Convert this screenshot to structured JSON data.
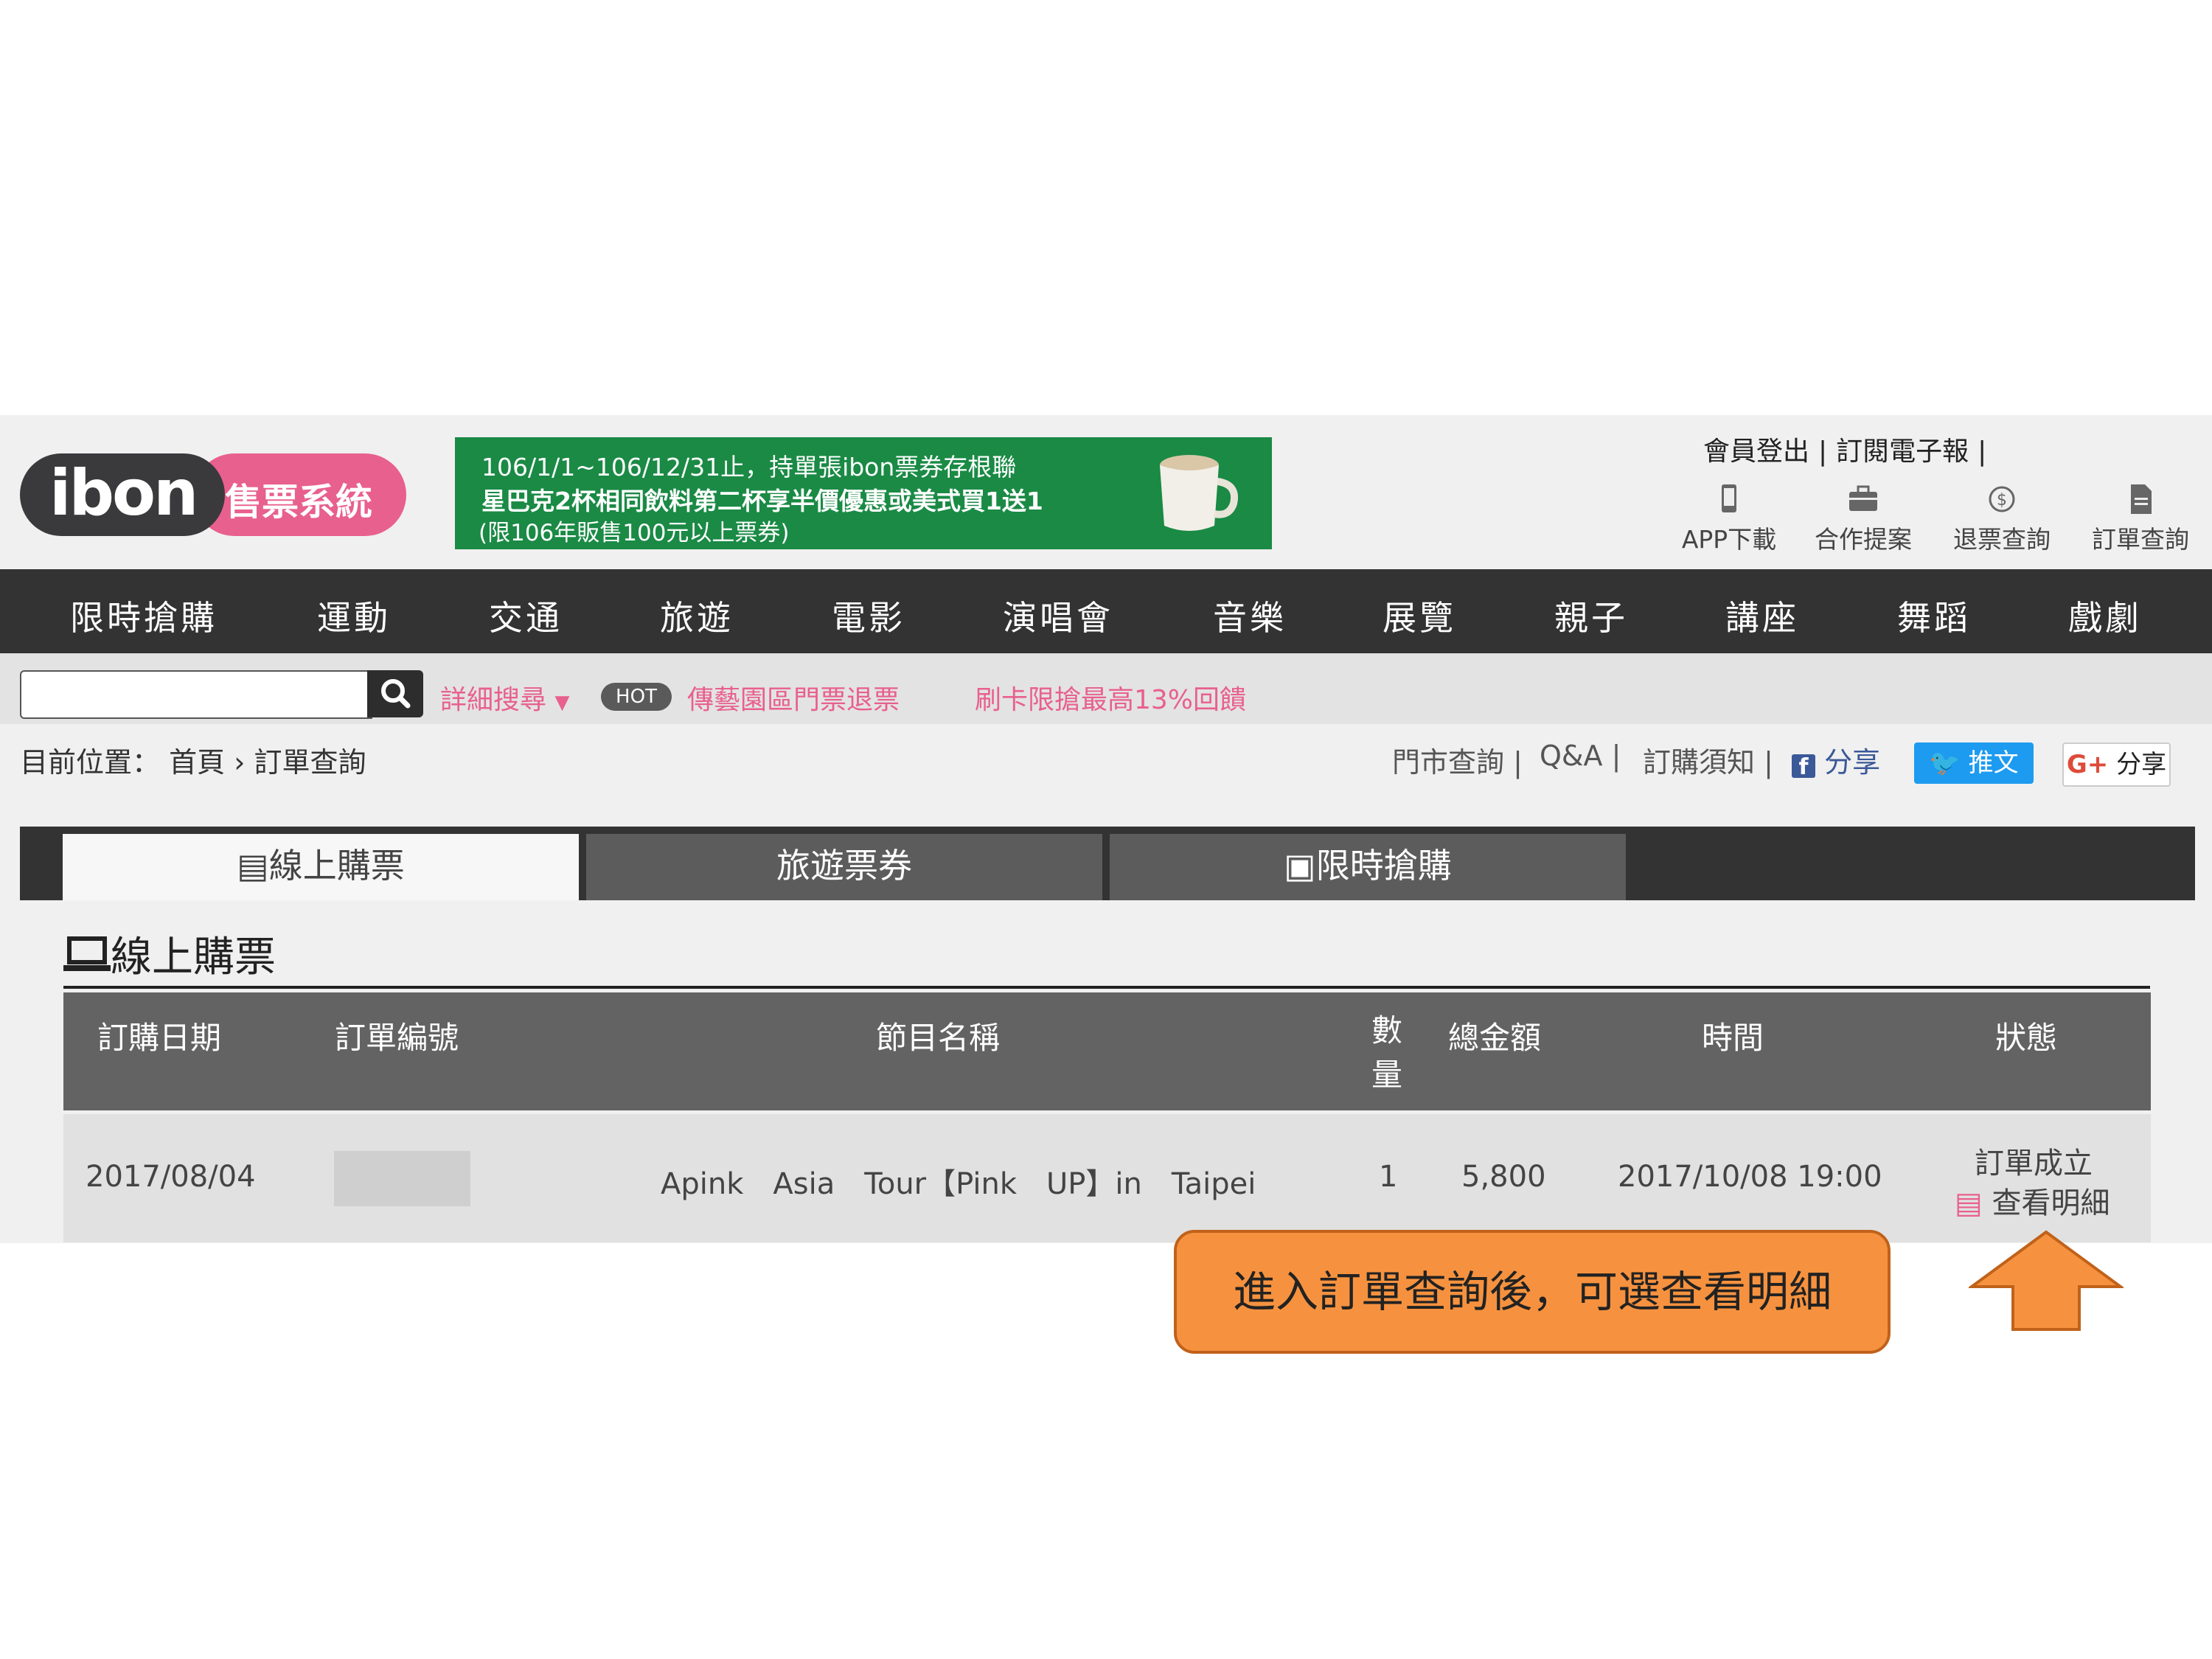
{
  "header": {
    "logo_text": "ibon",
    "logo_sub": "售票系統",
    "banner": {
      "line1": "106/1/1~106/12/31止，持單張ibon票券存根聯",
      "line2": "星巴克2杯相同飲料第二杯享半價優惠或美式買1送1",
      "line3": "(限106年販售100元以上票券)"
    },
    "top_links": [
      "會員登出",
      "訂閱電子報"
    ],
    "tools": [
      {
        "label": "APP下載",
        "icon": "mobile-icon"
      },
      {
        "label": "合作提案",
        "icon": "briefcase-icon"
      },
      {
        "label": "退票查詢",
        "icon": "refund-icon"
      },
      {
        "label": "訂單查詢",
        "icon": "document-icon"
      }
    ]
  },
  "nav": [
    "限時搶購",
    "運動",
    "交通",
    "旅遊",
    "電影",
    "演唱會",
    "音樂",
    "展覽",
    "親子",
    "講座",
    "舞蹈",
    "戲劇"
  ],
  "search": {
    "placeholder": "",
    "advanced": "詳細搜尋",
    "hot_badge": "HOT",
    "promo1": "傳藝園區門票退票",
    "promo2": "刷卡限搶最高13%回饋"
  },
  "breadcrumb": {
    "label": "目前位置：",
    "home": "首頁",
    "sep": "›",
    "current": "訂單查詢"
  },
  "utility": {
    "store": "門市查詢",
    "qa": "Q&A",
    "notice": "訂購須知",
    "fb_share": "分享",
    "tweet": "推文",
    "gplus_share": "分享"
  },
  "tabs": [
    "線上購票",
    "旅遊票券",
    "限時搶購"
  ],
  "section_title": "線上購票",
  "table": {
    "headers": [
      "訂購日期",
      "訂單編號",
      "節目名稱",
      "數量",
      "總金額",
      "時間",
      "狀態"
    ],
    "rows": [
      {
        "date": "2017/08/04",
        "order_no": "",
        "program": "Apink　Asia　Tour【Pink　UP】in　Taipei",
        "qty": "1",
        "total": "5,800",
        "time": "2017/10/08 19:00",
        "status": "訂單成立",
        "detail_link": "查看明細"
      }
    ]
  },
  "callout": "進入訂單查詢後，可選查看明細",
  "colors": {
    "brand_pink": "#e8608e",
    "nav_dark": "#333333",
    "banner_green": "#1a8a45",
    "callout_orange": "#f6923f"
  }
}
